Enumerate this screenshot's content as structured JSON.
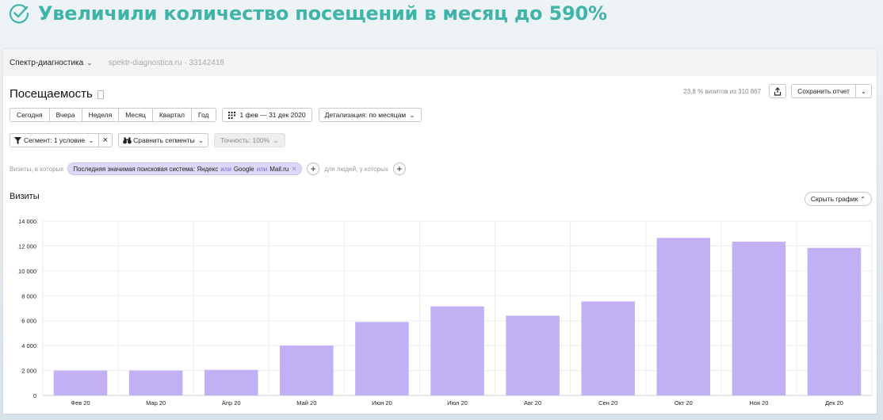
{
  "headline": {
    "text": "Увеличили количество посещений в месяц до 590%"
  },
  "topbar": {
    "site": "Спектр-диагностика",
    "url": "spektr-diagnostica.ru · 33142418"
  },
  "report": {
    "title": "Посещаемость",
    "visits_info": "23,8 % визитов из 310 867",
    "save_label": "Сохранить отчет"
  },
  "periods": [
    "Сегодня",
    "Вчера",
    "Неделя",
    "Месяц",
    "Квартал",
    "Год"
  ],
  "date_range": "1 фев — 31 дек 2020",
  "detail_label": "Детализация: по месяцам",
  "segment_label": "Сегмент: 1 условие",
  "compare_label": "Сравнить сегменты",
  "accuracy_label": "Точность: 100%",
  "filter": {
    "prefix": "Визиты, в которых",
    "chip_main": "Последняя значимая поисковая система: Яндекс",
    "or1": "или",
    "google": "Google",
    "or2": "или",
    "mail": "Mail.ru",
    "suffix": "для людей, у которых"
  },
  "chart_section": {
    "title": "Визиты",
    "hide_label": "Скрыть график"
  },
  "colors": {
    "bar": "#c2b0f5",
    "headline": "#3fb4a8",
    "chip": "#ddd8f6"
  },
  "chart_data": {
    "type": "bar",
    "categories": [
      "Фев 20",
      "Мар 20",
      "Апр 20",
      "Май 20",
      "Июн 20",
      "Июл 20",
      "Авг 20",
      "Сен 20",
      "Окт 20",
      "Ноя 20",
      "Дек 20"
    ],
    "values": [
      2000,
      2000,
      2050,
      4000,
      5900,
      7150,
      6400,
      7550,
      12650,
      12350,
      11850
    ],
    "ylim": [
      0,
      14000
    ],
    "yticks": [
      0,
      2000,
      4000,
      6000,
      8000,
      10000,
      12000,
      14000
    ],
    "ytick_labels": [
      "0",
      "2 000",
      "4 000",
      "6 000",
      "8 000",
      "10 000",
      "12 000",
      "14 000"
    ],
    "grid": true
  }
}
